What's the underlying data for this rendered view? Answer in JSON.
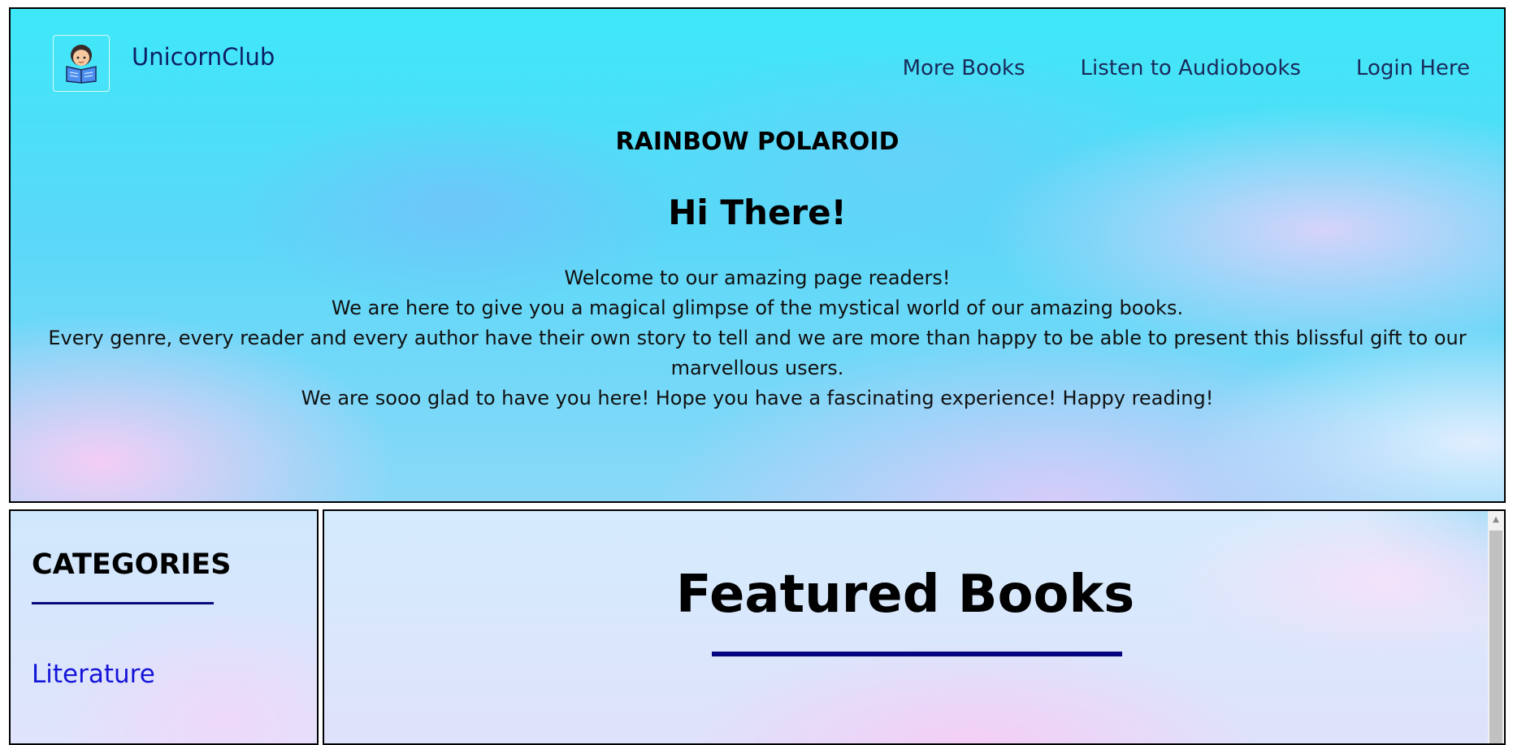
{
  "header": {
    "brand": "UnicornClub",
    "logo_icon": "reading-child-icon",
    "nav": [
      "More Books",
      "Listen to Audiobooks",
      "Login Here"
    ],
    "subtitle": "RAINBOW POLAROID",
    "greeting": "Hi There!",
    "welcome_lines": [
      "Welcome to our amazing page readers!",
      "We are here to give you a magical glimpse of the mystical world of our amazing books.",
      "Every genre, every reader and every author have their own story to tell and we are more than happy to be able to present this blissful gift to our marvellous users.",
      "We are sooo glad to have you here! Hope you have a fascinating experience! Happy reading!"
    ]
  },
  "sidebar": {
    "title": "CATEGORIES",
    "items": [
      "Literature"
    ]
  },
  "main": {
    "title": "Featured Books"
  },
  "colors": {
    "link": "#1515d8",
    "underline": "#040480",
    "brand": "#0d1f66"
  }
}
